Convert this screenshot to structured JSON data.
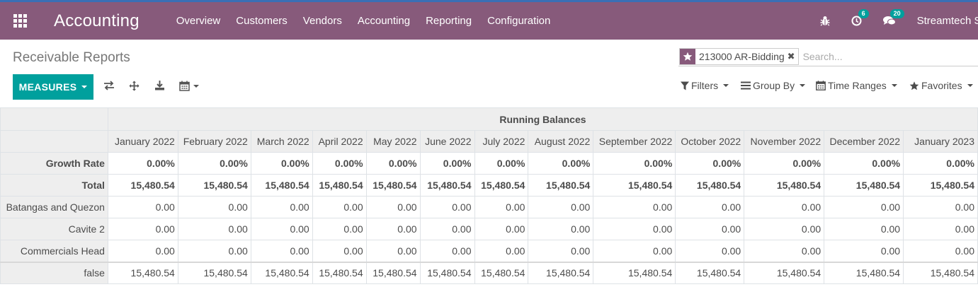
{
  "navbar": {
    "brand": "Accounting",
    "menu": [
      "Overview",
      "Customers",
      "Vendors",
      "Accounting",
      "Reporting",
      "Configuration"
    ],
    "activity_count": "6",
    "messages_count": "20",
    "company": "Streamtech Sy",
    "icons": [
      "apps-grid-icon",
      "bug-icon",
      "clock-icon",
      "chat-icon"
    ]
  },
  "breadcrumb": "Receivable Reports",
  "search": {
    "facet_label": "213000 AR-Bidding",
    "placeholder": "Search..."
  },
  "toolbar": {
    "measures_label": "MEASURES",
    "icons": [
      "flip-axis-icon",
      "expand-all-icon",
      "download-icon",
      "calendar-icon"
    ]
  },
  "search_options": {
    "filters": "Filters",
    "group_by": "Group By",
    "time_ranges": "Time Ranges",
    "favorites": "Favorites"
  },
  "pivot": {
    "header": "Running Balances",
    "columns": [
      "January 2022",
      "February 2022",
      "March 2022",
      "April 2022",
      "May 2022",
      "June 2022",
      "July 2022",
      "August 2022",
      "September 2022",
      "October 2022",
      "November 2022",
      "December 2022",
      "January 2023"
    ],
    "rows": [
      {
        "label": "Growth Rate",
        "values": [
          "0.00%",
          "0.00%",
          "0.00%",
          "0.00%",
          "0.00%",
          "0.00%",
          "0.00%",
          "0.00%",
          "0.00%",
          "0.00%",
          "0.00%",
          "0.00%",
          "0.00%"
        ]
      },
      {
        "label": "Total",
        "values": [
          "15,480.54",
          "15,480.54",
          "15,480.54",
          "15,480.54",
          "15,480.54",
          "15,480.54",
          "15,480.54",
          "15,480.54",
          "15,480.54",
          "15,480.54",
          "15,480.54",
          "15,480.54",
          "15,480.54"
        ]
      },
      {
        "label": "Batangas and Quezon",
        "values": [
          "0.00",
          "0.00",
          "0.00",
          "0.00",
          "0.00",
          "0.00",
          "0.00",
          "0.00",
          "0.00",
          "0.00",
          "0.00",
          "0.00",
          "0.00"
        ]
      },
      {
        "label": "Cavite 2",
        "values": [
          "0.00",
          "0.00",
          "0.00",
          "0.00",
          "0.00",
          "0.00",
          "0.00",
          "0.00",
          "0.00",
          "0.00",
          "0.00",
          "0.00",
          "0.00"
        ]
      },
      {
        "label": "Commercials Head",
        "values": [
          "0.00",
          "0.00",
          "0.00",
          "0.00",
          "0.00",
          "0.00",
          "0.00",
          "0.00",
          "0.00",
          "0.00",
          "0.00",
          "0.00",
          "0.00"
        ]
      },
      {
        "label": "false",
        "values": [
          "15,480.54",
          "15,480.54",
          "15,480.54",
          "15,480.54",
          "15,480.54",
          "15,480.54",
          "15,480.54",
          "15,480.54",
          "15,480.54",
          "15,480.54",
          "15,480.54",
          "15,480.54",
          "15,480.54"
        ]
      }
    ]
  },
  "colors": {
    "navbar": "#875a7b",
    "primary_button": "#00a09d",
    "badge": "#00a09d",
    "header_bg": "#eeeeee"
  }
}
